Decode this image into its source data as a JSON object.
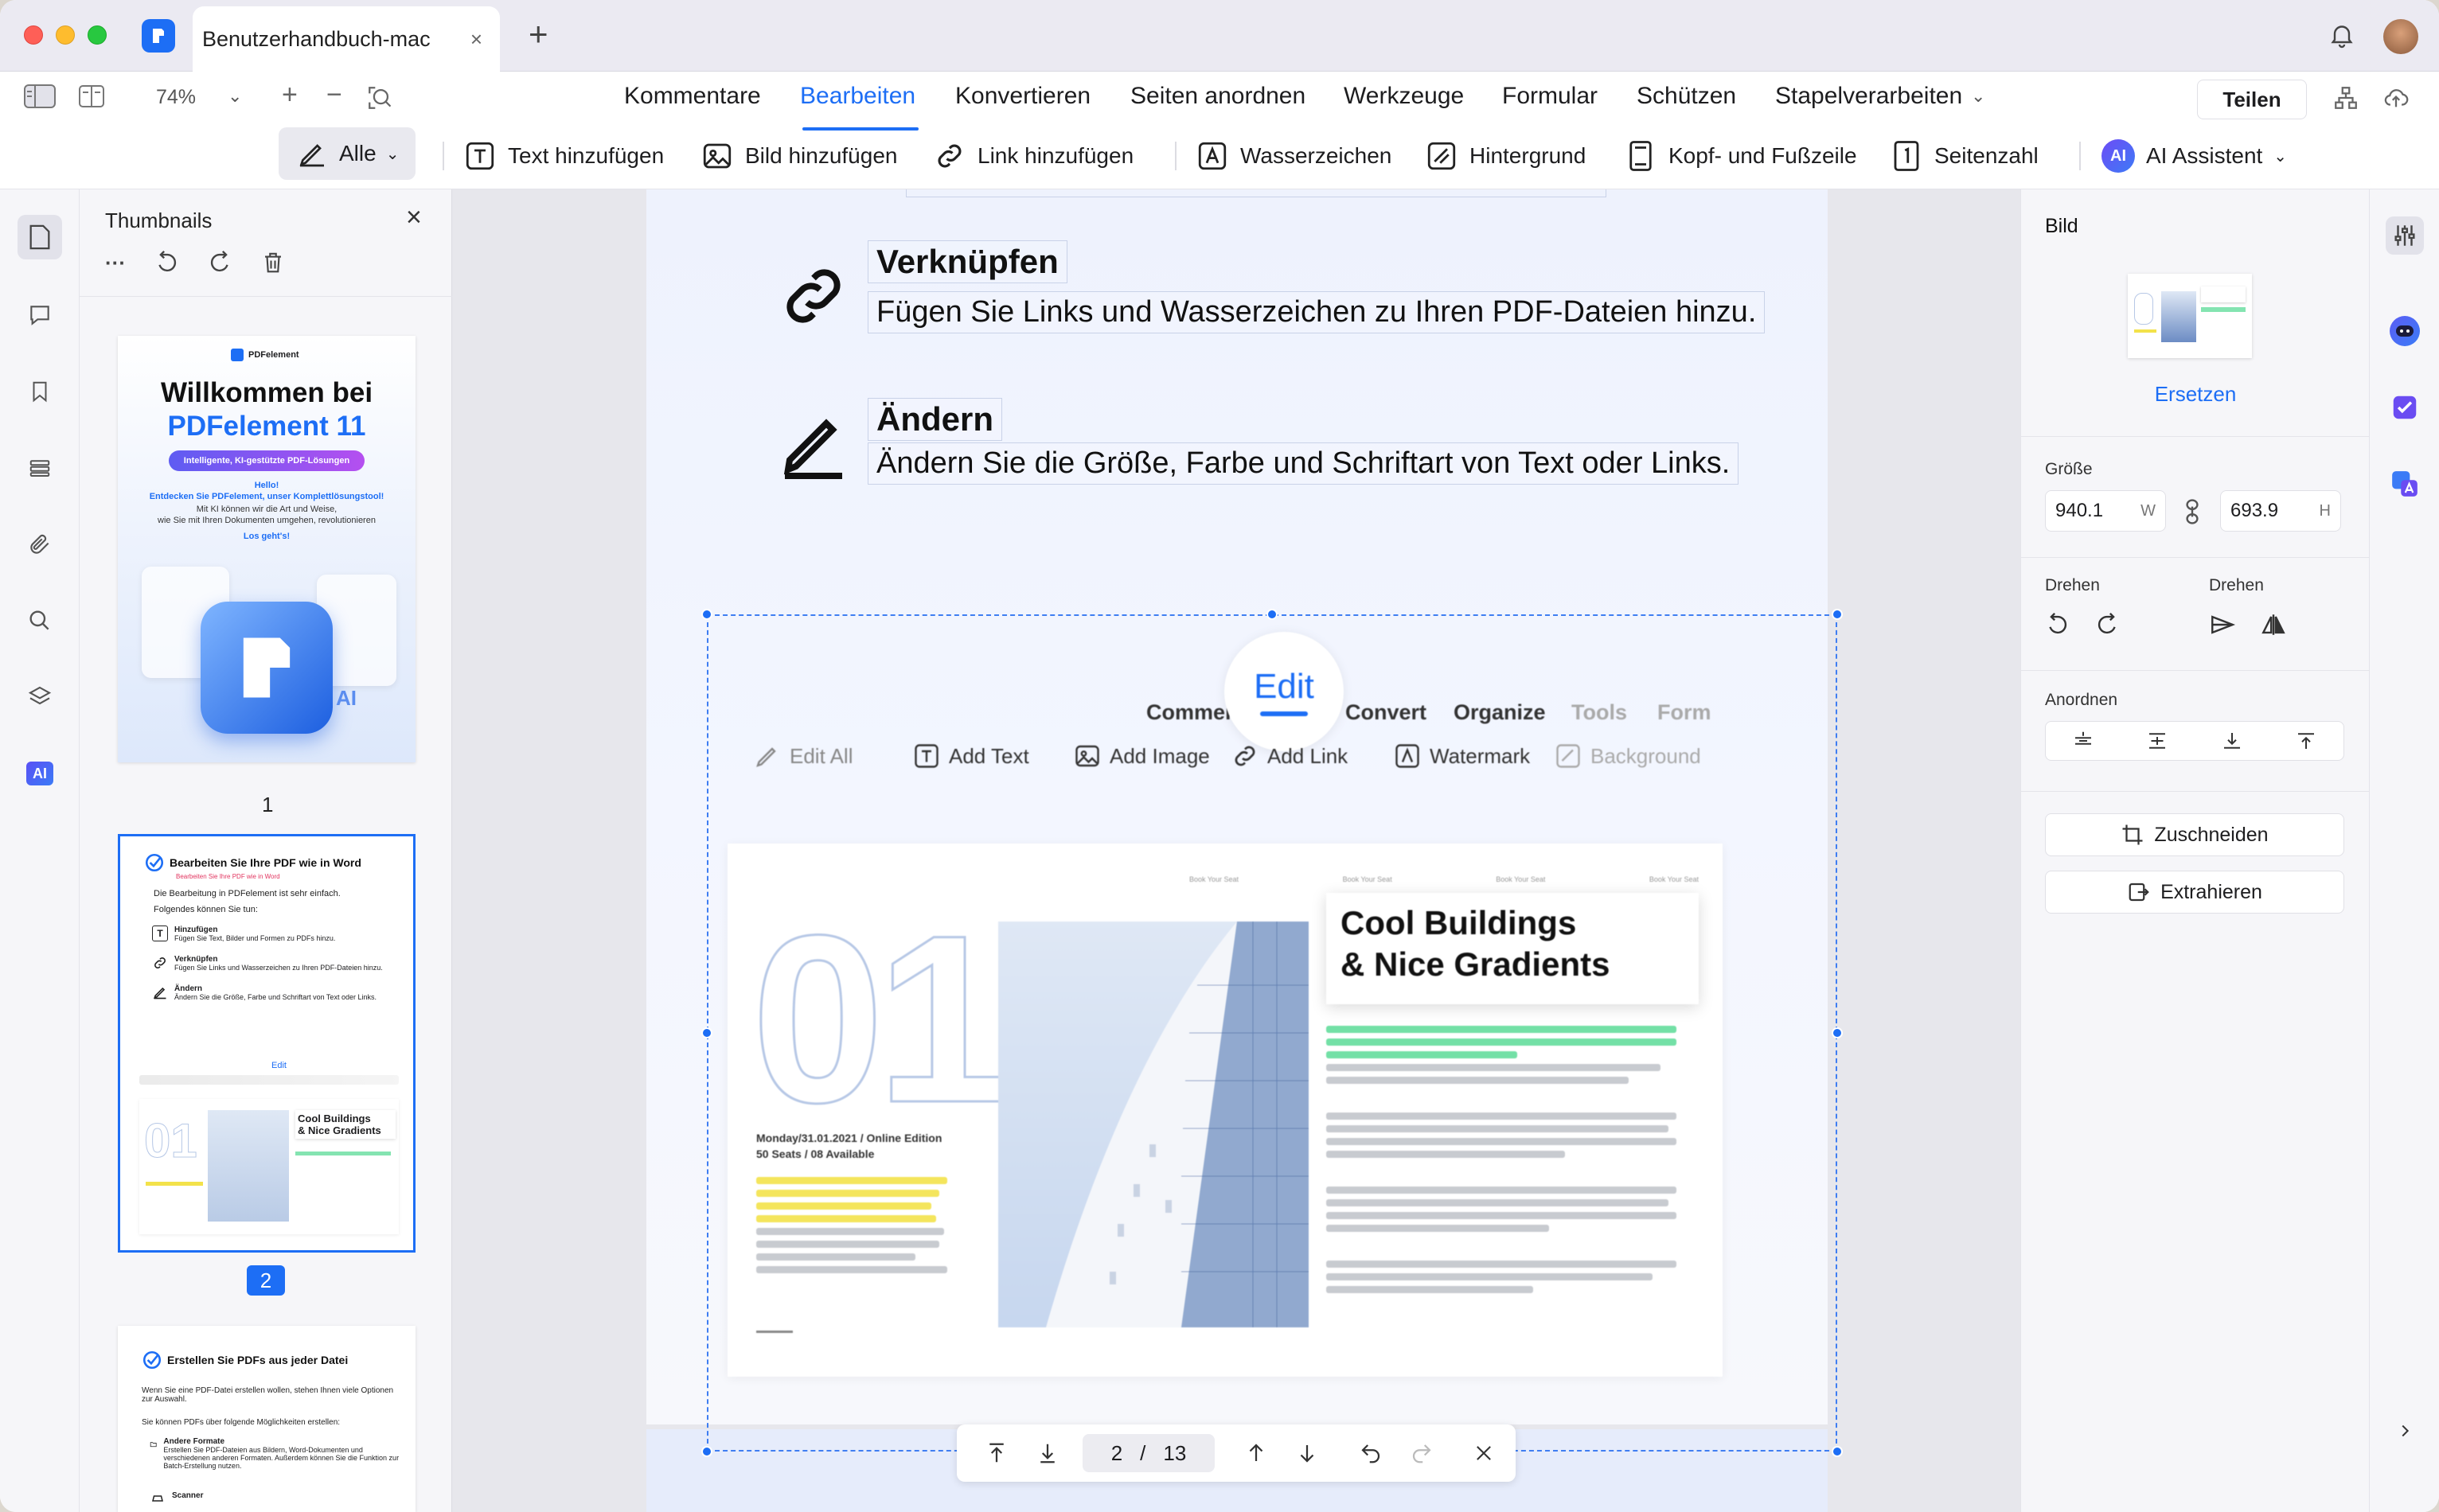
{
  "window": {
    "tab_title": "Benutzerhandbuch-mac",
    "tab_close": "×",
    "tab_add": "+"
  },
  "menubar": {
    "zoom": "74%",
    "items": [
      "Kommentare",
      "Bearbeiten",
      "Konvertieren",
      "Seiten anordnen",
      "Werkzeuge",
      "Formular",
      "Schützen",
      "Stapelverarbeiten"
    ],
    "active_index": 1,
    "share_label": "Teilen"
  },
  "toolbar": {
    "mode_label": "Alle",
    "items": [
      "Text hinzufügen",
      "Bild hinzufügen",
      "Link hinzufügen",
      "Wasserzeichen",
      "Hintergrund",
      "Kopf- und Fußzeile",
      "Seitenzahl"
    ],
    "ai_label": "AI Assistent"
  },
  "thumbnails": {
    "title": "Thumbnails",
    "more": "···",
    "pages": [
      {
        "number": "1",
        "brand": "PDFelement",
        "heading_1": "Willkommen bei",
        "heading_2": "PDFelement 11",
        "pill": "Intelligente, KI-gestützte PDF-Lösungen",
        "hello": "Hello!",
        "line_1": "Entdecken Sie PDFelement, unser Komplettlösungstool!",
        "line_2": "Mit KI können wir die Art und Weise,",
        "line_3": "wie Sie mit Ihren Dokumenten umgehen, revolutionieren",
        "cta": "Los geht's!"
      },
      {
        "number": "2",
        "title": "Bearbeiten Sie Ihre PDF wie in Word",
        "subtitle": "Bearbeiten Sie Ihre PDF wie in Word",
        "intro": "Die Bearbeitung in PDFelement ist sehr einfach.",
        "intro_2": "Folgendes können Sie tun:",
        "items": [
          {
            "title": "Hinzufügen",
            "desc": "Fügen Sie Text, Bilder und Formen zu PDFs hinzu."
          },
          {
            "title": "Verknüpfen",
            "desc": "Fügen Sie Links und Wasserzeichen zu Ihren PDF-Dateien hinzu."
          },
          {
            "title": "Ändern",
            "desc": "Ändern Sie die Größe, Farbe und Schriftart von Text oder Links."
          }
        ],
        "mini_edit": "Edit",
        "mini_headline_1": "Cool Buildings",
        "mini_headline_2": "& Nice Gradients"
      },
      {
        "number": "3",
        "title": "Erstellen Sie PDFs aus jeder Datei",
        "intro": "Wenn Sie eine PDF-Datei erstellen wollen, stehen Ihnen viele Optionen zur Auswahl.",
        "intro_2": "Sie können PDFs über folgende Möglichkeiten erstellen:",
        "items": [
          {
            "title": "Andere Formate",
            "desc": "Erstellen Sie PDF-Dateien aus Bildern, Word-Dokumenten und verschiedenen anderen Formaten. Außerdem können Sie die Funktion zur Batch-Erstellung nutzen."
          },
          {
            "title": "Scanner",
            "desc": ""
          }
        ]
      }
    ]
  },
  "document": {
    "features": [
      {
        "title": "Verknüpfen",
        "desc": "Fügen Sie Links und Wasserzeichen zu Ihren PDF-Dateien hinzu."
      },
      {
        "title": "Ändern",
        "desc": "Ändern Sie die Größe, Farbe und Schriftart von Text oder Links."
      }
    ],
    "embedded": {
      "menu": [
        "Commen",
        "Convert",
        "Organize",
        "Tools",
        "Form"
      ],
      "edit_label": "Edit",
      "tools": [
        "Edit All",
        "Add Text",
        "Add Image",
        "Add Link",
        "Watermark",
        "Background"
      ],
      "big_number": "01",
      "nav_links": [
        "Book Your Seat",
        "Book Your Seat",
        "Book Your Seat",
        "Book Your Seat"
      ],
      "headline_1": "Cool Buildings",
      "headline_2": "& Nice Gradients",
      "date_line": "Monday/31.01.2021 / Online Edition",
      "seats_line": "50 Seats / 08 Available"
    }
  },
  "pagenav": {
    "current": "2",
    "separator": "/",
    "total": "13"
  },
  "properties": {
    "title": "Bild",
    "replace": "Ersetzen",
    "size_label": "Größe",
    "width": "940.1",
    "width_unit": "W",
    "height": "693.9",
    "height_unit": "H",
    "rotate_label": "Drehen",
    "flip_label": "Drehen",
    "arrange_label": "Anordnen",
    "crop": "Zuschneiden",
    "extract": "Extrahieren"
  },
  "colors": {
    "accent": "#1d6ef5",
    "highlight_green": "#50d890",
    "highlight_yellow": "#f3e24a"
  }
}
